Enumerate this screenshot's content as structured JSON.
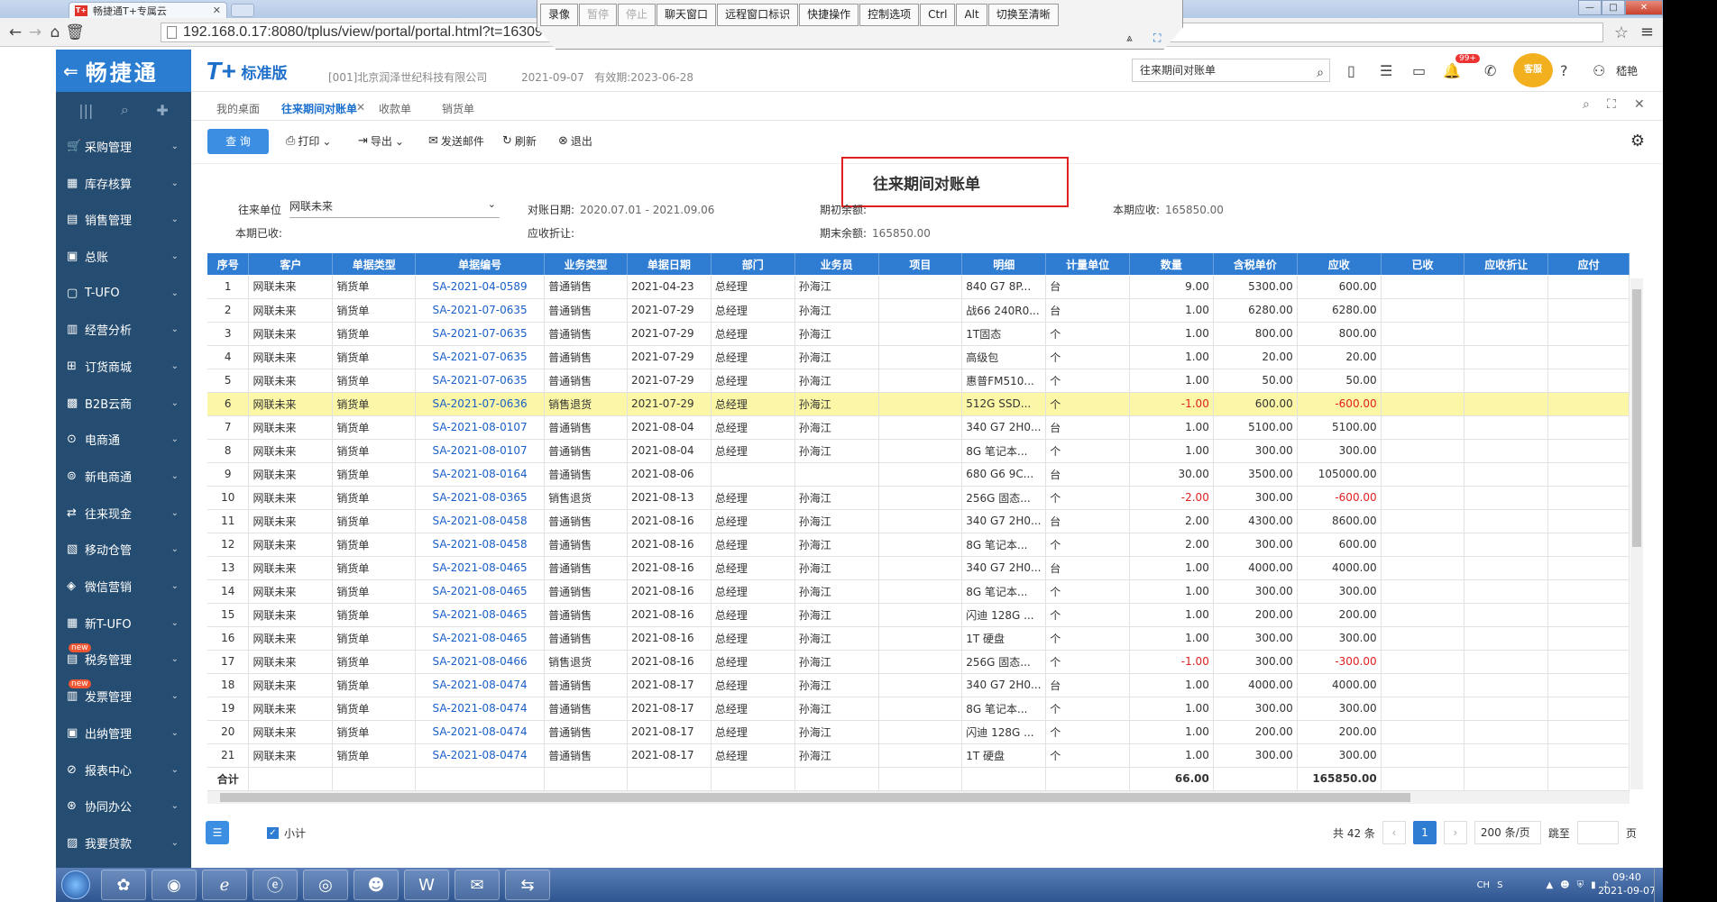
{
  "browser": {
    "tab_title": "畅捷通T+专属云",
    "tab_favicon": "T+",
    "url": "192.168.0.17:8080/tplus/view/portal/portal.html?t=1630977735538",
    "window_buttons": [
      "—",
      "□",
      "✕"
    ]
  },
  "remote_toolbar": {
    "buttons": [
      {
        "label": "录像",
        "disabled": false
      },
      {
        "label": "暂停",
        "disabled": true
      },
      {
        "label": "停止",
        "disabled": true
      },
      {
        "label": "聊天窗口",
        "disabled": false
      },
      {
        "label": "远程窗口标识",
        "disabled": false
      },
      {
        "label": "快捷操作",
        "disabled": false
      },
      {
        "label": "控制选项",
        "disabled": false
      },
      {
        "label": "Ctrl",
        "disabled": false
      },
      {
        "label": "Alt",
        "disabled": false
      },
      {
        "label": "切换至清晰",
        "disabled": false
      }
    ]
  },
  "header": {
    "brand": "畅捷通",
    "product_logo": "T+",
    "edition": "标准版",
    "company": "[001]北京润泽世纪科技有限公司",
    "date": "2021-09-07",
    "validity": "有效期:2023-06-28",
    "search_value": "往来期间对账单",
    "badge": "99+",
    "service_label": "客服",
    "user": "嵇艳"
  },
  "sidebar": {
    "items": [
      {
        "label": "采购管理",
        "icon": "cart-icon",
        "new": false
      },
      {
        "label": "库存核算",
        "icon": "inventory-icon",
        "new": false
      },
      {
        "label": "销售管理",
        "icon": "sales-icon",
        "new": false
      },
      {
        "label": "总账",
        "icon": "ledger-icon",
        "new": false
      },
      {
        "label": "T-UFO",
        "icon": "ufo-icon",
        "new": false
      },
      {
        "label": "经营分析",
        "icon": "analysis-icon",
        "new": false
      },
      {
        "label": "订货商城",
        "icon": "mall-icon",
        "new": false
      },
      {
        "label": "B2B云商",
        "icon": "b2b-icon",
        "new": false
      },
      {
        "label": "电商通",
        "icon": "ecommerce-icon",
        "new": false
      },
      {
        "label": "新电商通",
        "icon": "new-ecommerce-icon",
        "new": false
      },
      {
        "label": "往来现金",
        "icon": "cash-icon",
        "new": false
      },
      {
        "label": "移动仓管",
        "icon": "mobile-warehouse-icon",
        "new": false
      },
      {
        "label": "微信营销",
        "icon": "wechat-icon",
        "new": false
      },
      {
        "label": "新T-UFO",
        "icon": "new-ufo-icon",
        "new": false
      },
      {
        "label": "税务管理",
        "icon": "tax-icon",
        "new": true
      },
      {
        "label": "发票管理",
        "icon": "invoice-icon",
        "new": true
      },
      {
        "label": "出纳管理",
        "icon": "cashier-icon",
        "new": false
      },
      {
        "label": "报表中心",
        "icon": "report-icon",
        "new": false
      },
      {
        "label": "协同办公",
        "icon": "collab-icon",
        "new": false
      },
      {
        "label": "我要贷款",
        "icon": "loan-icon",
        "new": false
      }
    ],
    "new_label": "new"
  },
  "tabs": [
    "我的桌面",
    "往来期间对账单",
    "收款单",
    "销货单"
  ],
  "toolbar": {
    "query": "查 询",
    "print": "打印",
    "export": "导出",
    "email": "发送邮件",
    "refresh": "刷新",
    "exit": "退出"
  },
  "report": {
    "title": "往来期间对账单",
    "unit_label": "往来单位",
    "unit_value": "网联未来",
    "period_label": "对账日期:",
    "period_value": "2020.07.01 - 2021.09.06",
    "opening_label": "期初余额:",
    "current_receivable_label": "本期应收:",
    "current_receivable_value": "165850.00",
    "received_label": "本期已收:",
    "discount_label": "应收折让:",
    "closing_label": "期末余额:",
    "closing_value": "165850.00"
  },
  "table": {
    "columns": [
      "序号",
      "客户",
      "单据类型",
      "单据编号",
      "业务类型",
      "单据日期",
      "部门",
      "业务员",
      "项目",
      "明细",
      "计量单位",
      "数量",
      "含税单价",
      "应收",
      "已收",
      "应收折让",
      "应付"
    ],
    "rows": [
      [
        "1",
        "网联未来",
        "销货单",
        "SA-2021-04-0589",
        "普通销售",
        "2021-04-23",
        "总经理",
        "孙海江",
        "",
        "840 G7 8P...",
        "台",
        "9.00",
        "5300.00",
        "600.00"
      ],
      [
        "2",
        "网联未来",
        "销货单",
        "SA-2021-07-0635",
        "普通销售",
        "2021-07-29",
        "总经理",
        "孙海江",
        "",
        "战66 240R0...",
        "台",
        "1.00",
        "6280.00",
        "6280.00"
      ],
      [
        "3",
        "网联未来",
        "销货单",
        "SA-2021-07-0635",
        "普通销售",
        "2021-07-29",
        "总经理",
        "孙海江",
        "",
        "1T固态",
        "个",
        "1.00",
        "800.00",
        "800.00"
      ],
      [
        "4",
        "网联未来",
        "销货单",
        "SA-2021-07-0635",
        "普通销售",
        "2021-07-29",
        "总经理",
        "孙海江",
        "",
        "高级包",
        "个",
        "1.00",
        "20.00",
        "20.00"
      ],
      [
        "5",
        "网联未来",
        "销货单",
        "SA-2021-07-0635",
        "普通销售",
        "2021-07-29",
        "总经理",
        "孙海江",
        "",
        "惠普FM510...",
        "个",
        "1.00",
        "50.00",
        "50.00"
      ],
      [
        "6",
        "网联未来",
        "销货单",
        "SA-2021-07-0636",
        "销售退货",
        "2021-07-29",
        "总经理",
        "孙海江",
        "",
        "512G SSD...",
        "个",
        "-1.00",
        "600.00",
        "-600.00"
      ],
      [
        "7",
        "网联未来",
        "销货单",
        "SA-2021-08-0107",
        "普通销售",
        "2021-08-04",
        "总经理",
        "孙海江",
        "",
        "340 G7 2H0...",
        "台",
        "1.00",
        "5100.00",
        "5100.00"
      ],
      [
        "8",
        "网联未来",
        "销货单",
        "SA-2021-08-0107",
        "普通销售",
        "2021-08-04",
        "总经理",
        "孙海江",
        "",
        "8G 笔记本...",
        "个",
        "1.00",
        "300.00",
        "300.00"
      ],
      [
        "9",
        "网联未来",
        "销货单",
        "SA-2021-08-0164",
        "普通销售",
        "2021-08-06",
        "",
        "",
        "",
        "680 G6 9C...",
        "台",
        "30.00",
        "3500.00",
        "105000.00"
      ],
      [
        "10",
        "网联未来",
        "销货单",
        "SA-2021-08-0365",
        "销售退货",
        "2021-08-13",
        "总经理",
        "孙海江",
        "",
        "256G 固态...",
        "个",
        "-2.00",
        "300.00",
        "-600.00"
      ],
      [
        "11",
        "网联未来",
        "销货单",
        "SA-2021-08-0458",
        "普通销售",
        "2021-08-16",
        "总经理",
        "孙海江",
        "",
        "340 G7 2H0...",
        "台",
        "2.00",
        "4300.00",
        "8600.00"
      ],
      [
        "12",
        "网联未来",
        "销货单",
        "SA-2021-08-0458",
        "普通销售",
        "2021-08-16",
        "总经理",
        "孙海江",
        "",
        "8G 笔记本...",
        "个",
        "2.00",
        "300.00",
        "600.00"
      ],
      [
        "13",
        "网联未来",
        "销货单",
        "SA-2021-08-0465",
        "普通销售",
        "2021-08-16",
        "总经理",
        "孙海江",
        "",
        "340 G7 2H0...",
        "台",
        "1.00",
        "4000.00",
        "4000.00"
      ],
      [
        "14",
        "网联未来",
        "销货单",
        "SA-2021-08-0465",
        "普通销售",
        "2021-08-16",
        "总经理",
        "孙海江",
        "",
        "8G 笔记本...",
        "个",
        "1.00",
        "300.00",
        "300.00"
      ],
      [
        "15",
        "网联未来",
        "销货单",
        "SA-2021-08-0465",
        "普通销售",
        "2021-08-16",
        "总经理",
        "孙海江",
        "",
        "闪迪 128G ...",
        "个",
        "1.00",
        "200.00",
        "200.00"
      ],
      [
        "16",
        "网联未来",
        "销货单",
        "SA-2021-08-0465",
        "普通销售",
        "2021-08-16",
        "总经理",
        "孙海江",
        "",
        "1T 硬盘",
        "个",
        "1.00",
        "300.00",
        "300.00"
      ],
      [
        "17",
        "网联未来",
        "销货单",
        "SA-2021-08-0466",
        "销售退货",
        "2021-08-16",
        "总经理",
        "孙海江",
        "",
        "256G 固态...",
        "个",
        "-1.00",
        "300.00",
        "-300.00"
      ],
      [
        "18",
        "网联未来",
        "销货单",
        "SA-2021-08-0474",
        "普通销售",
        "2021-08-17",
        "总经理",
        "孙海江",
        "",
        "340 G7 2H0...",
        "台",
        "1.00",
        "4000.00",
        "4000.00"
      ],
      [
        "19",
        "网联未来",
        "销货单",
        "SA-2021-08-0474",
        "普通销售",
        "2021-08-17",
        "总经理",
        "孙海江",
        "",
        "8G 笔记本...",
        "个",
        "1.00",
        "300.00",
        "300.00"
      ],
      [
        "20",
        "网联未来",
        "销货单",
        "SA-2021-08-0474",
        "普通销售",
        "2021-08-17",
        "总经理",
        "孙海江",
        "",
        "闪迪 128G ...",
        "个",
        "1.00",
        "200.00",
        "200.00"
      ],
      [
        "21",
        "网联未来",
        "销货单",
        "SA-2021-08-0474",
        "普通销售",
        "2021-08-17",
        "总经理",
        "孙海江",
        "",
        "1T 硬盘",
        "个",
        "1.00",
        "300.00",
        "300.00"
      ]
    ],
    "highlighted_row": 6,
    "total_label": "合计",
    "total_qty": "66.00",
    "total_receivable": "165850.00"
  },
  "footer": {
    "subtotal_label": "小计",
    "total_count": "共 42 条",
    "prev": "‹",
    "current_page": "1",
    "next": "›",
    "page_size": "200 条/页",
    "jump_label": "跳至",
    "page_suffix": "页"
  },
  "taskbar": {
    "lang": "CH",
    "time": "09:40",
    "date": "2021-09-07"
  },
  "colors": {
    "accent": "#2f7dd3",
    "sidebar": "#254d71",
    "highlight_row": "#fbf7a6",
    "negative": "#e02020",
    "callout_border": "#e02020"
  }
}
